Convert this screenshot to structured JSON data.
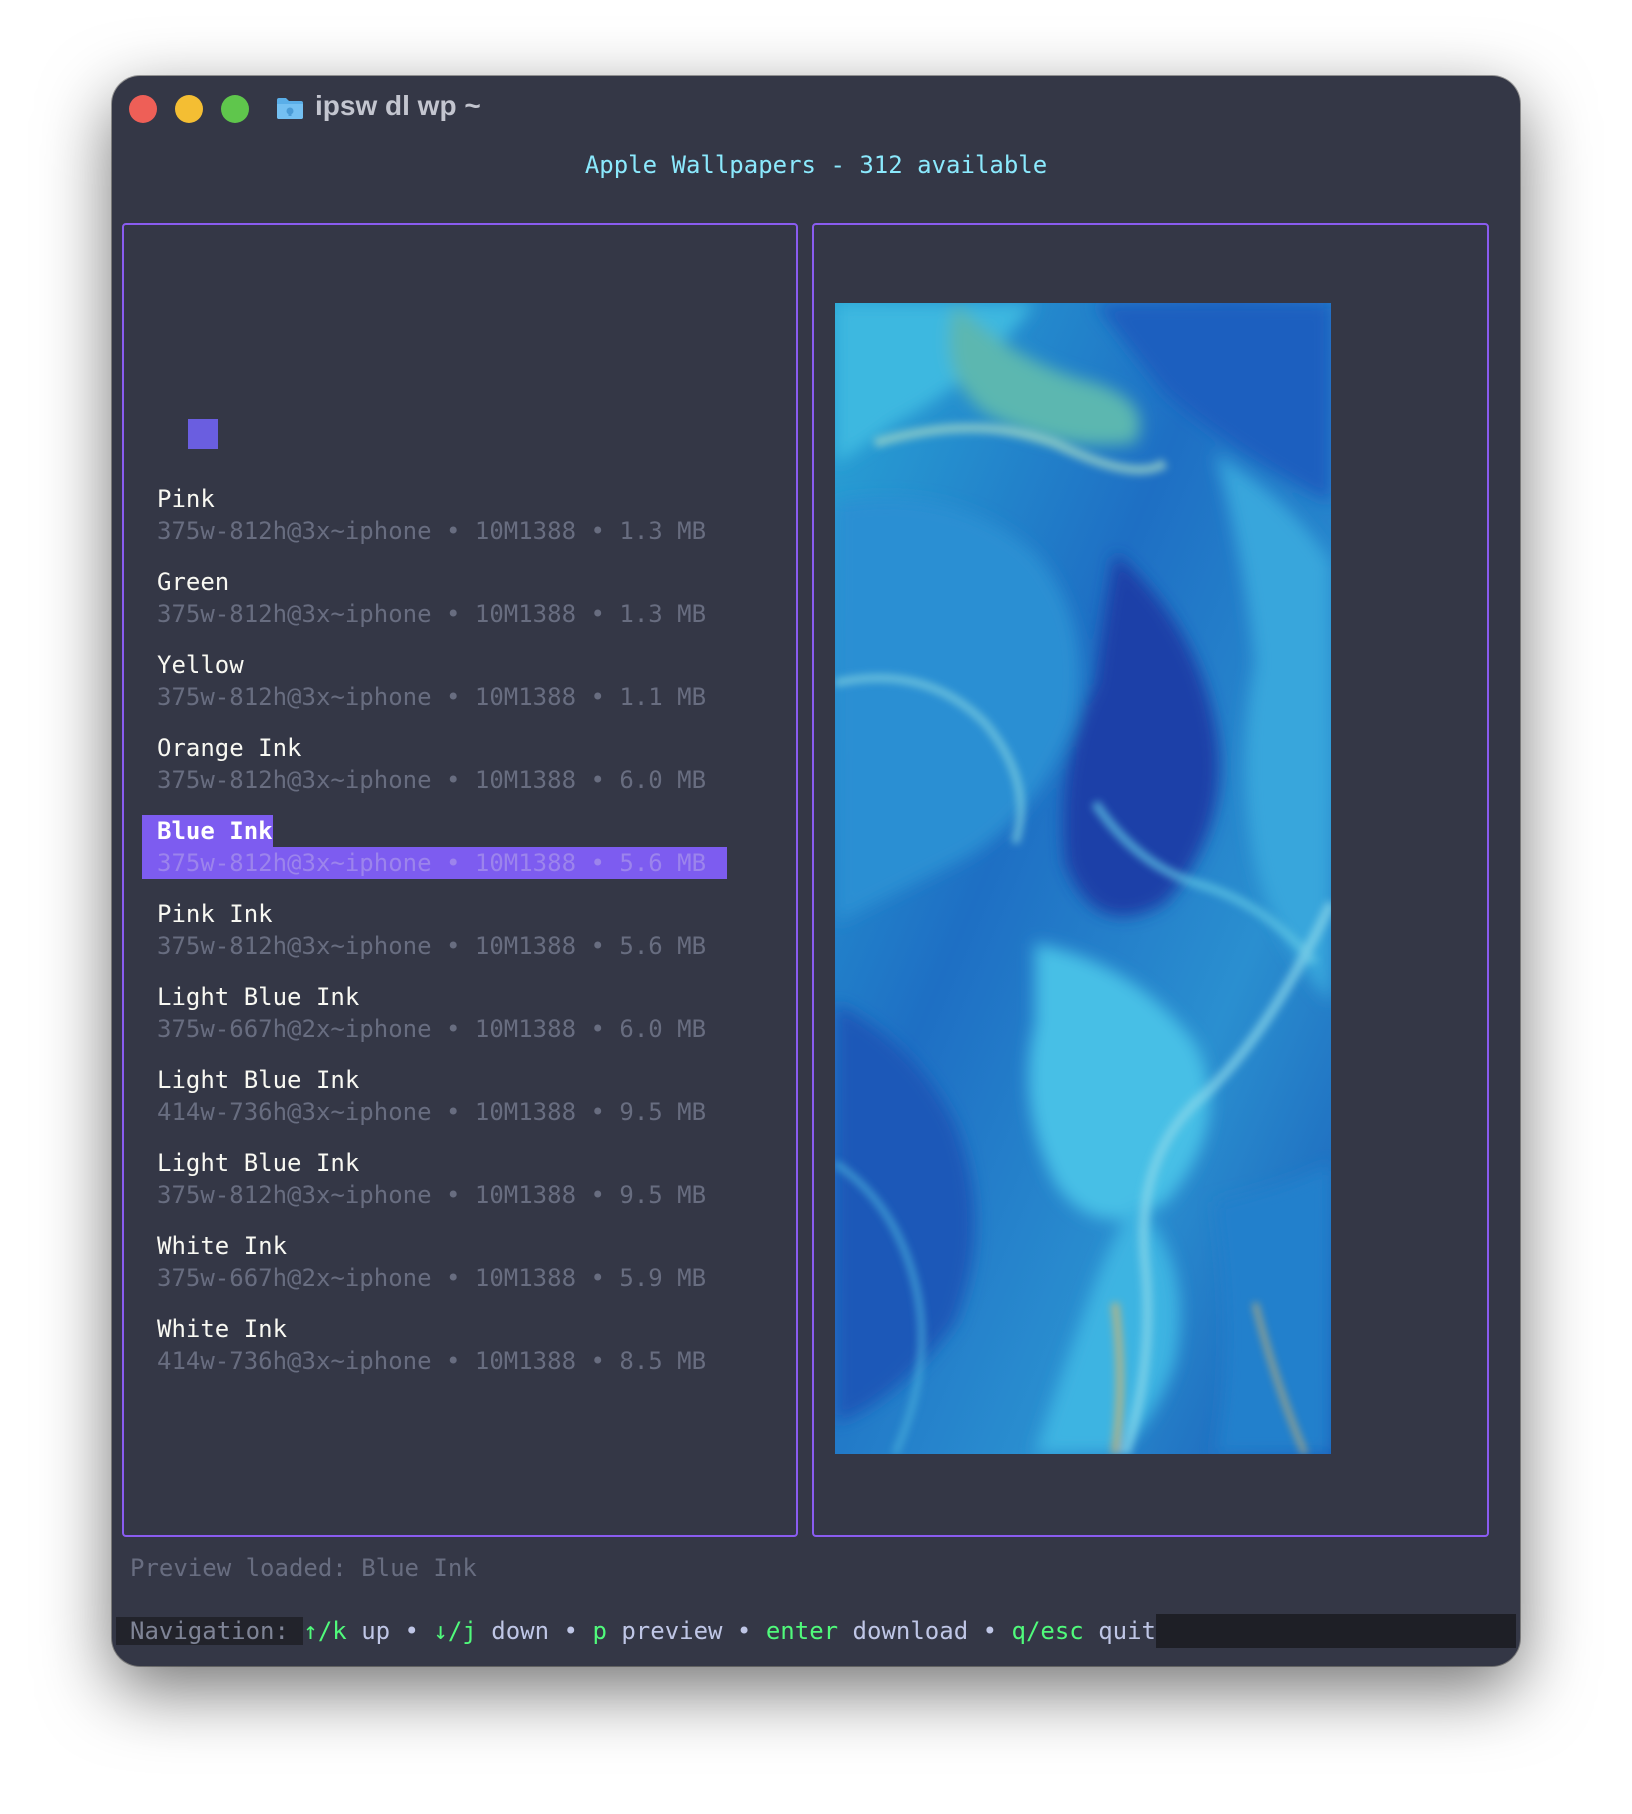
{
  "window": {
    "title": "ipsw dl wp ~"
  },
  "header": {
    "title": "Apple Wallpapers - 312 available"
  },
  "list": {
    "items": [
      {
        "name": "Pink",
        "meta": "375w-812h@3x~iphone • 10M1388 • 1.3 MB"
      },
      {
        "name": "Green",
        "meta": "375w-812h@3x~iphone • 10M1388 • 1.3 MB"
      },
      {
        "name": "Yellow",
        "meta": "375w-812h@3x~iphone • 10M1388 • 1.1 MB"
      },
      {
        "name": "Orange Ink",
        "meta": "375w-812h@3x~iphone • 10M1388 • 6.0 MB"
      },
      {
        "name": "Blue Ink",
        "meta": "375w-812h@3x~iphone • 10M1388 • 5.6 MB",
        "selected": true
      },
      {
        "name": "Pink Ink",
        "meta": "375w-812h@3x~iphone • 10M1388 • 5.6 MB"
      },
      {
        "name": "Light Blue Ink",
        "meta": "375w-667h@2x~iphone • 10M1388 • 6.0 MB"
      },
      {
        "name": "Light Blue Ink",
        "meta": "414w-736h@3x~iphone • 10M1388 • 9.5 MB"
      },
      {
        "name": "Light Blue Ink",
        "meta": "375w-812h@3x~iphone • 10M1388 • 9.5 MB"
      },
      {
        "name": "White Ink",
        "meta": "375w-667h@2x~iphone • 10M1388 • 5.9 MB"
      },
      {
        "name": "White Ink",
        "meta": "414w-736h@3x~iphone • 10M1388 • 8.5 MB"
      }
    ]
  },
  "preview": {
    "image": "blue-ink-wallpaper"
  },
  "status": {
    "text": "Preview loaded: Blue Ink"
  },
  "nav": {
    "label": "Navigation: ",
    "up_key": "↑/k",
    "up": " up",
    "down_key": "↓/j",
    "down": " down",
    "preview_key": "p",
    "preview": " preview",
    "enter_key": "enter",
    "download": " download",
    "quit_key": "q/esc",
    "quit": " quit",
    "sep": " • "
  },
  "colors": {
    "background": "#343746",
    "accent": "#8a5cf0",
    "selected": "#7d5cf0",
    "header": "#8be9fd",
    "key": "#50fa7b",
    "muted": "#686d80"
  }
}
